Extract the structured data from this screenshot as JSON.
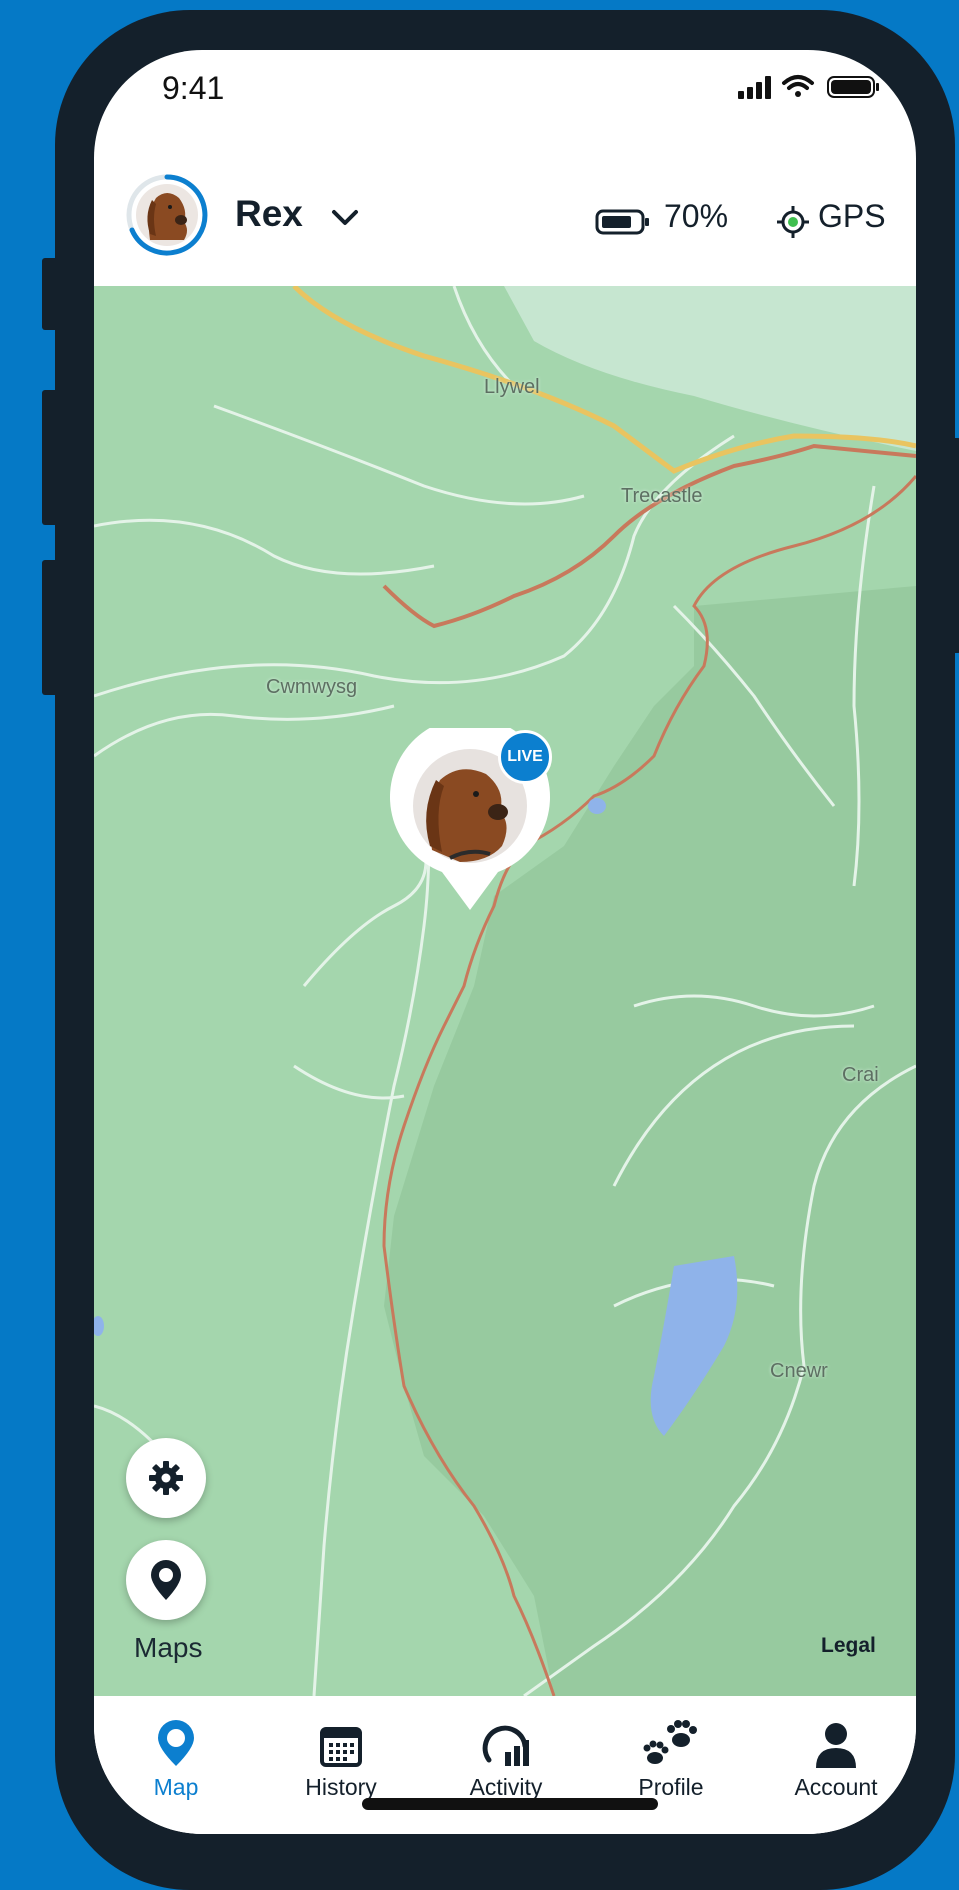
{
  "status_bar": {
    "time": "9:41"
  },
  "header": {
    "pet_name": "Rex",
    "battery_percent": "70%",
    "location_mode": "GPS"
  },
  "map": {
    "places": [
      "Llywel",
      "Trecastle",
      "Cwmwysg",
      "Crai",
      "Cnewr"
    ],
    "live_badge": "LIVE",
    "maps_label": "Maps",
    "legal_link": "Legal"
  },
  "tabs": [
    {
      "label": "Map",
      "icon": "map-pin-icon",
      "active": true
    },
    {
      "label": "History",
      "icon": "calendar-icon",
      "active": false
    },
    {
      "label": "Activity",
      "icon": "activity-chart-icon",
      "active": false
    },
    {
      "label": "Profile",
      "icon": "paw-icon",
      "active": false
    },
    {
      "label": "Account",
      "icon": "person-icon",
      "active": false
    }
  ],
  "colors": {
    "accent": "#0c7fcf",
    "background": "#0579c6",
    "device_frame": "#14202b",
    "map_green": "#a4d6ad"
  }
}
